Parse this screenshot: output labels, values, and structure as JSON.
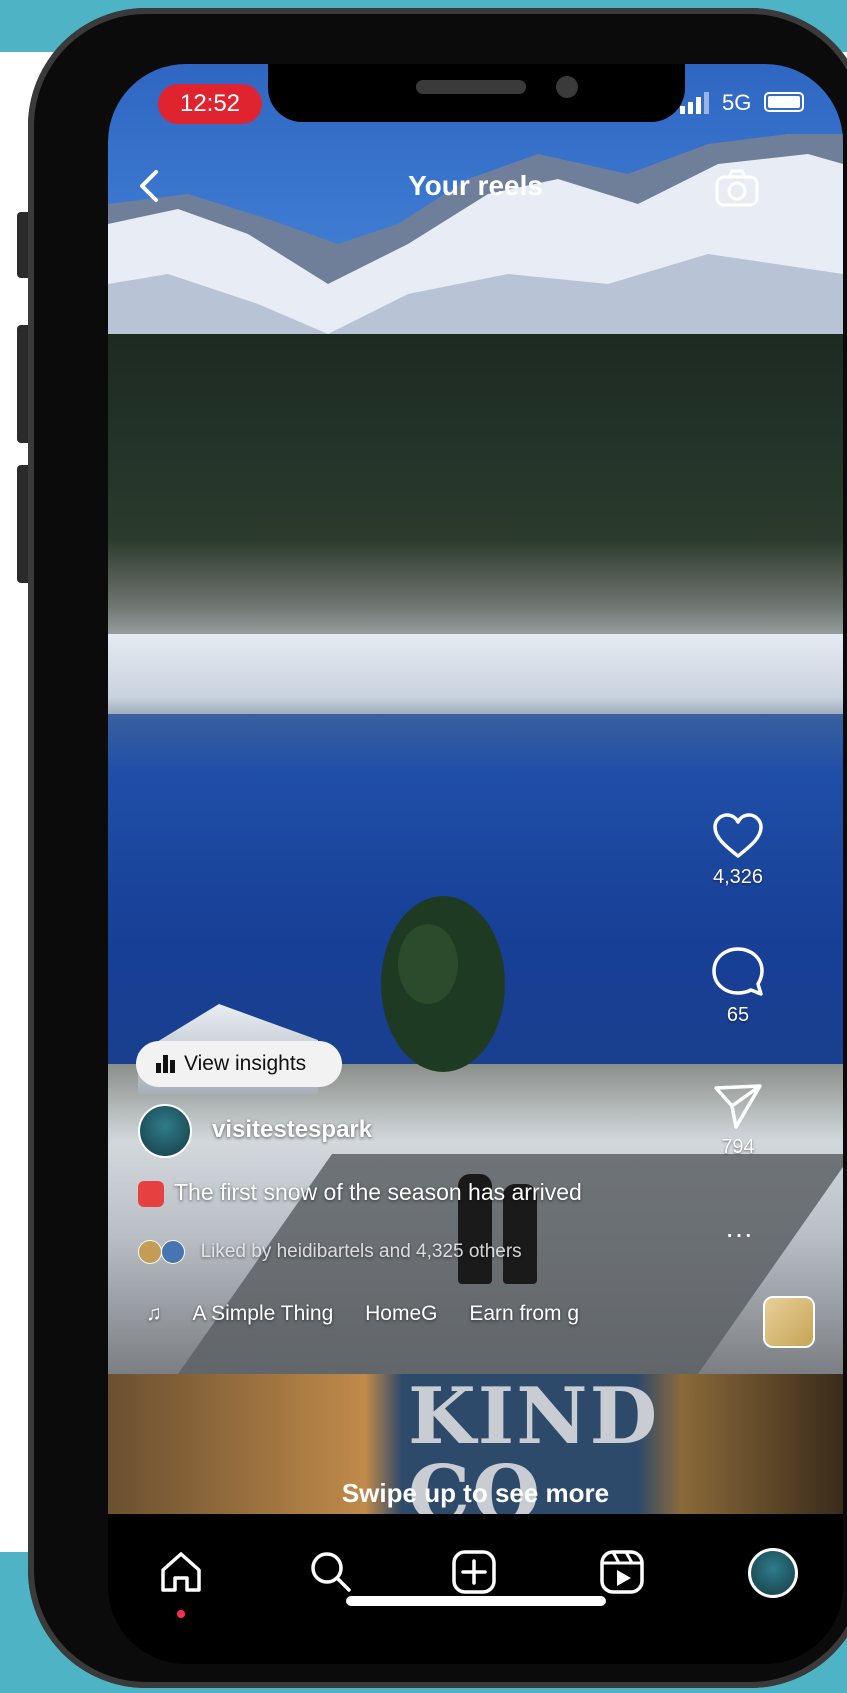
{
  "status_bar": {
    "time": "12:52",
    "network": "5G"
  },
  "header": {
    "title": "Your reels"
  },
  "actions": {
    "likes": "4,326",
    "comments": "65",
    "shares": "794",
    "more": "···"
  },
  "post": {
    "insights_label": "View insights",
    "username": "visitestespark",
    "caption": "The first snow of the season has arrived",
    "liked_by": "Liked by heidibartels and 4,325 others",
    "audio": [
      "A Simple Thing",
      "HomeG",
      "Earn from g"
    ]
  },
  "next_reel": {
    "sign_text": "KIND CO",
    "swipe_hint": "Swipe up to see more"
  },
  "icons": [
    "chevron-left-icon",
    "camera-icon",
    "heart-icon",
    "comment-icon",
    "send-icon",
    "music-note-icon",
    "home-icon",
    "search-icon",
    "create-icon",
    "reels-icon",
    "profile-avatar"
  ],
  "colors": {
    "time_pill": "#e0242f",
    "teal": "#4fb3c6",
    "nav_dot": "#ff2d55"
  }
}
